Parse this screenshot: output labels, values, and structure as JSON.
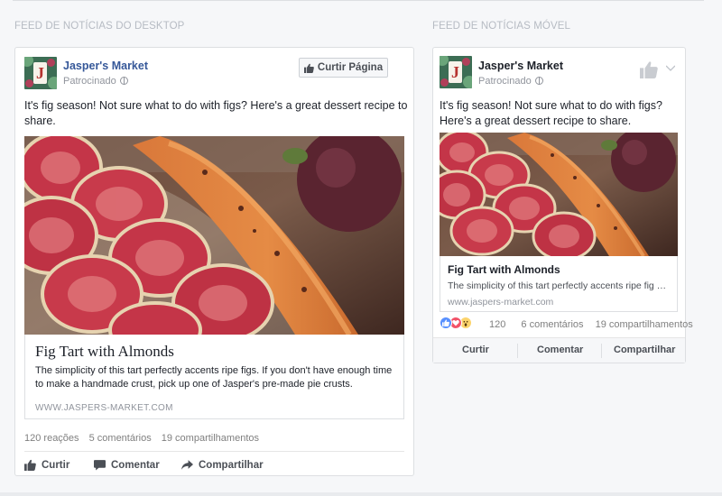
{
  "sections": {
    "desktop_label": "FEED DE NOTÍCIAS DO DESKTOP",
    "mobile_label": "FEED DE NOTÍCIAS MÓVEL"
  },
  "desktop": {
    "page_name": "Jasper's Market",
    "sponsored": "Patrocinado",
    "like_page_button": "Curtir Página",
    "post_text": "It's fig season! Not sure what to do with figs? Here's a great dessert recipe to share.",
    "link_title": "Fig Tart with Almonds",
    "link_description": "The simplicity of this tart perfectly accents ripe figs. If you don't have enough time to make a handmade crust, pick up one of Jasper's pre-made pie crusts.",
    "link_domain": "WWW.JASPERS-MARKET.COM",
    "stats": {
      "reactions": "120 reações",
      "comments": "5 comentários",
      "shares": "19 compartilhamentos"
    },
    "actions": {
      "like": "Curtir",
      "comment": "Comentar",
      "share": "Compartilhar"
    }
  },
  "mobile": {
    "page_name": "Jasper's Market",
    "sponsored": "Patrocinado",
    "post_text": "It's fig season! Not sure what to do with figs? Here's a great dessert recipe to share.",
    "link_title": "Fig Tart with Almonds",
    "link_description": "The simplicity of this tart perfectly accents ripe fig …",
    "link_domain": "www.jaspers-market.com",
    "stats": {
      "reactions": "120",
      "comments": "6 comentários",
      "shares": "19 compartilhamentos"
    },
    "actions": {
      "like": "Curtir",
      "comment": "Comentar",
      "share": "Compartilhar"
    }
  },
  "icons": [
    "thumbs-up-icon",
    "globe-icon",
    "comment-icon",
    "share-arrow-icon",
    "chevron-down-icon",
    "like-reaction-icon",
    "love-reaction-icon",
    "wow-reaction-icon"
  ],
  "colors": {
    "link_blue": "#365899",
    "text_gray": "#90949c",
    "like_blue": "#5890ff",
    "love_red": "#f25268",
    "wow_yellow": "#fcd46c"
  }
}
